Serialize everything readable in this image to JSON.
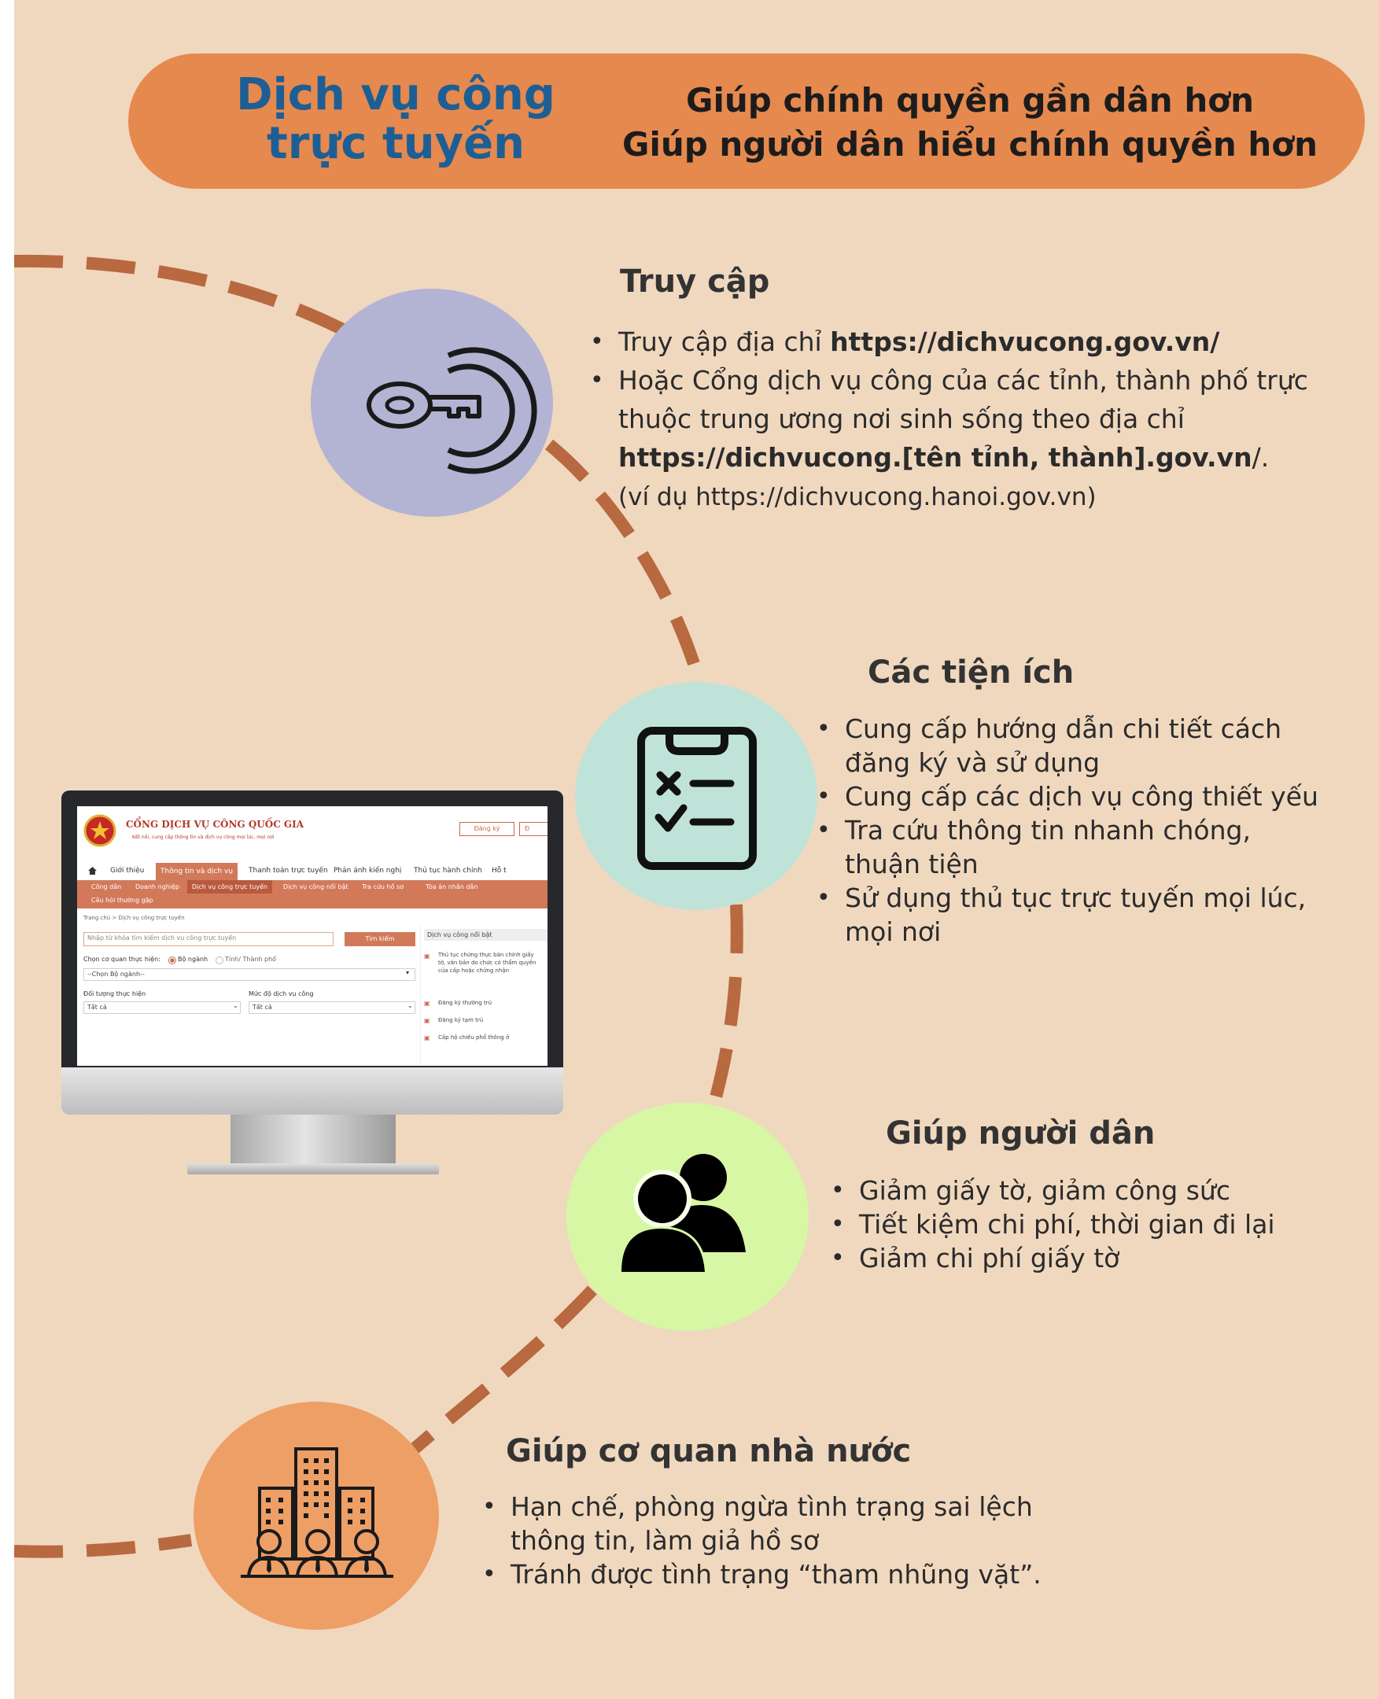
{
  "banner": {
    "title_line1": "Dịch vụ công",
    "title_line2": "trực tuyến",
    "slogan_line1": "Giúp chính quyền gần dân hơn",
    "slogan_line2": "Giúp người dân hiểu chính quyền hơn"
  },
  "sections": {
    "access": {
      "heading": "Truy cập",
      "bullet1_prefix": "Truy cập địa chỉ ",
      "bullet1_link": "https://dichvucong.gov.vn/",
      "bullet2_line1": "Hoặc Cổng dịch vụ công của các tỉnh, thành phố trực",
      "bullet2_line2": "thuộc trung ương nơi sinh sống theo địa chỉ",
      "bullet2_link": "https://dichvucong.[tên tỉnh, thành].gov.vn",
      "bullet2_suffix": "/.",
      "example": "(ví dụ https://dichvucong.hanoi.gov.vn)"
    },
    "utilities": {
      "heading": "Các tiện ích",
      "items": [
        {
          "l1": "Cung cấp hướng dẫn chi tiết cách",
          "l2": "đăng ký và sử dụng"
        },
        {
          "l1": "Cung cấp các dịch vụ công thiết yếu",
          "l2": ""
        },
        {
          "l1": "Tra cứu thông tin nhanh chóng,",
          "l2": "thuận tiện"
        },
        {
          "l1": "Sử dụng thủ tục trực tuyến mọi lúc,",
          "l2": "mọi nơi"
        }
      ]
    },
    "citizens": {
      "heading": "Giúp người dân",
      "items": [
        "Giảm giấy tờ, giảm công sức",
        "Tiết kiệm chi phí, thời gian đi lại",
        "Giảm chi phí giấy tờ"
      ]
    },
    "agencies": {
      "heading": "Giúp cơ quan nhà nước",
      "item1_l1": "Hạn chế, phòng ngừa tình trạng sai lệch",
      "item1_l2": "thông tin, làm giả hồ sơ",
      "item2": "Tránh được tình trạng “tham nhũng vặt”."
    }
  },
  "screen": {
    "portal_title": "CỔNG DỊCH VỤ CÔNG QUỐC GIA",
    "portal_tagline": "Kết nối, cung cấp thông tin và dịch vụ công mọi lúc, mọi nơi",
    "register": "Đăng ký",
    "login_partial": "Đ",
    "nav": [
      "Giới thiệu",
      "Thông tin và dịch vụ",
      "Thanh toán trực tuyến",
      "Phản ánh kiến nghị",
      "Thủ tục hành chính",
      "Hỗ t"
    ],
    "sub_nav": [
      "Công dân",
      "Doanh nghiệp",
      "Dịch vụ công trực tuyến",
      "Dịch vụ công nổi bật",
      "Tra cứu hồ sơ",
      "Tòa án nhân dân"
    ],
    "sub_nav_row2": "Câu hỏi thường gặp",
    "breadcrumb": "Trang chủ  >  Dịch vụ công trực tuyến",
    "search_placeholder": "Nhập từ khóa tìm kiếm dịch vụ công trực tuyến",
    "search_button": "Tìm kiếm",
    "agency_label": "Chọn cơ quan thực hiện:",
    "radio1": "Bộ ngành",
    "radio2": "Tỉnh/ Thành phố",
    "ministry_select": "--Chọn Bộ ngành--",
    "subject_label": "Đối tượng thực hiện",
    "level_label": "Mức độ dịch vụ công",
    "all1": "Tất cả",
    "all2": "Tất cả",
    "featured_title": "Dịch vụ công nổi bật",
    "featured": [
      "Thủ tục chứng thực bản chính giấy tờ, văn bản do chức có thẩm quyền của cấp hoặc chứng nhận",
      "Đăng ký thường trú",
      "Đăng ký tạm trú",
      "Cấp hộ chiếu phổ thông ở"
    ]
  },
  "colors": {
    "background": "#f0d8bf",
    "banner": "#e6894e",
    "title_blue": "#1d5f95",
    "path_dashes": "#b8693f",
    "circle_access": "#b3b3d4",
    "circle_utilities": "#bfe3d8",
    "circle_citizens": "#d7f7a4",
    "circle_agencies": "#ee9f66"
  },
  "icons": {
    "access": "key-icon",
    "utilities": "checklist-clipboard-icon",
    "citizens": "people-group-icon",
    "agencies": "office-buildings-staff-icon"
  }
}
